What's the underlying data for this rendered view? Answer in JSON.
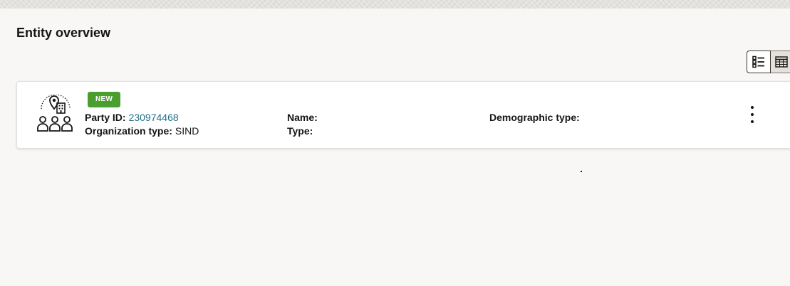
{
  "page": {
    "title": "Entity overview"
  },
  "view_toggle": {
    "active": "list",
    "options": [
      "list-view-icon",
      "table-view-icon"
    ]
  },
  "card": {
    "badge": "NEW",
    "party_id_label": "Party ID:",
    "party_id_value": "230974468",
    "org_type_label": "Organization type:",
    "org_type_value": "SIND",
    "name_label": "Name:",
    "type_label": "Type:",
    "demographic_label": "Demographic type:",
    "icon": "organization-group-icon"
  },
  "colors": {
    "badge_bg": "#4a9e2f",
    "link": "#227086",
    "page_bg": "#f8f7f5"
  }
}
